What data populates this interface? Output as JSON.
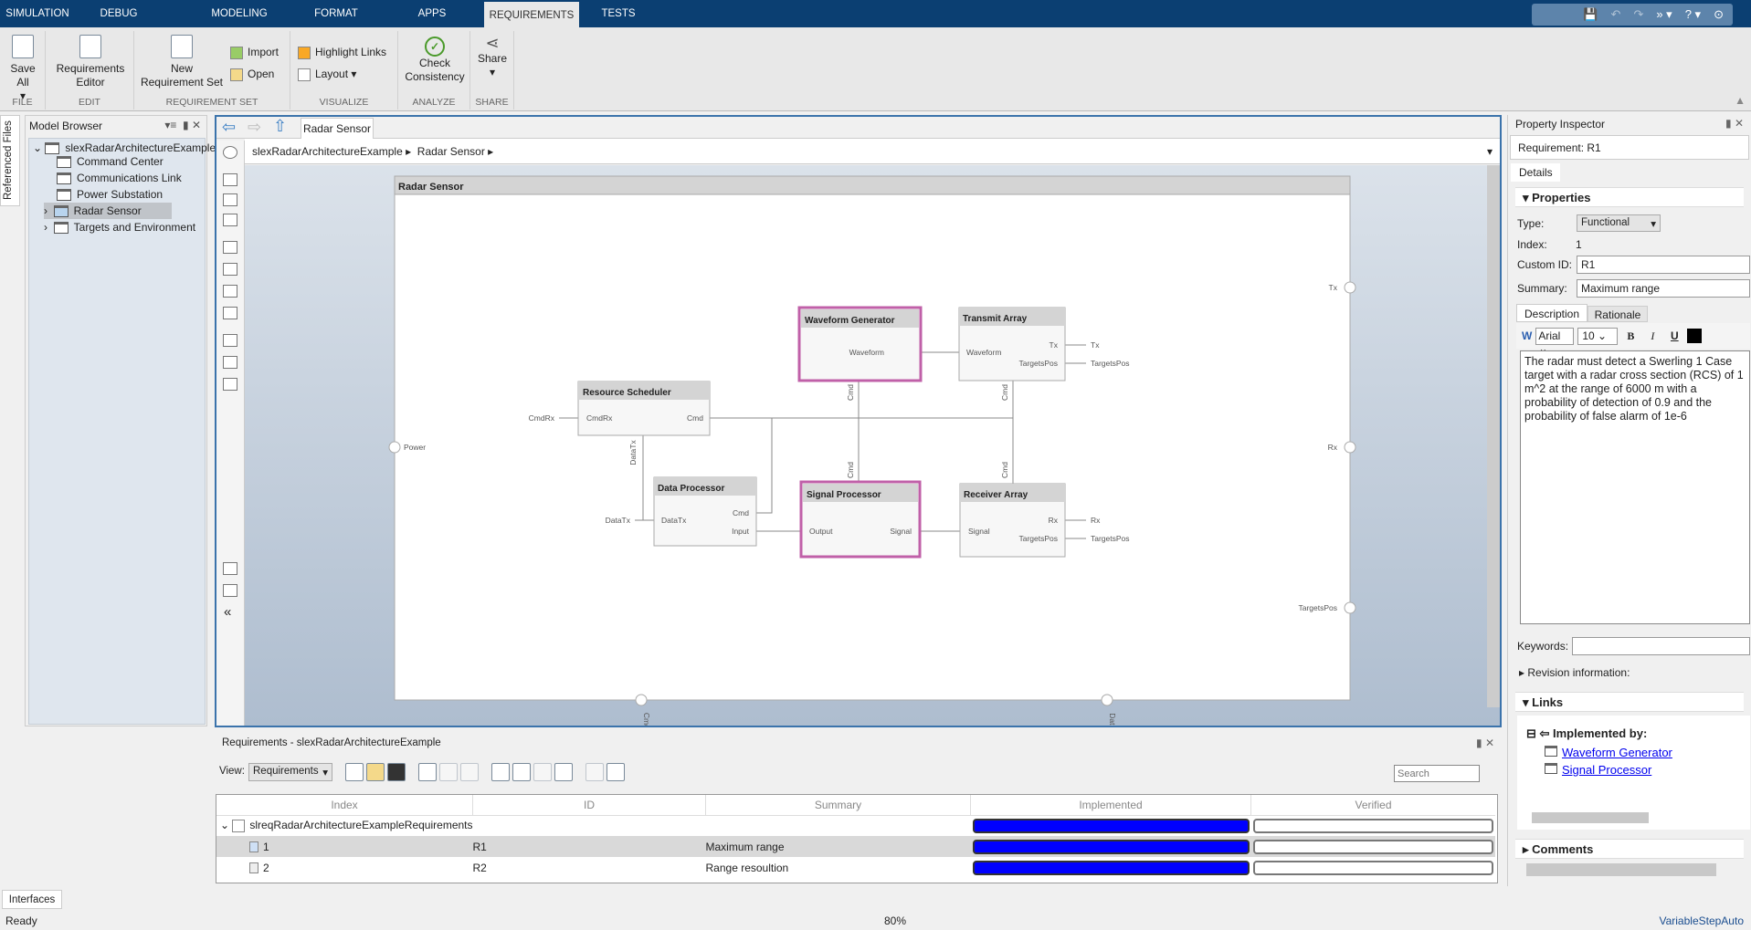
{
  "tabs": [
    "SIMULATION",
    "DEBUG",
    "MODELING",
    "FORMAT",
    "APPS",
    "REQUIREMENTS",
    "TESTS"
  ],
  "ribbon": {
    "groups": {
      "file": "FILE",
      "edit": "EDIT",
      "reqset": "REQUIREMENT SET",
      "visualize": "VISUALIZE",
      "analyze": "ANALYZE",
      "share": "SHARE"
    },
    "save_all": "Save All",
    "req_editor_1": "Requirements",
    "req_editor_2": "Editor",
    "new_req_1": "New",
    "new_req_2": "Requirement Set",
    "import": "Import",
    "open": "Open",
    "highlight_links": "Highlight Links",
    "layout": "Layout",
    "check_1": "Check",
    "check_2": "Consistency",
    "share": "Share"
  },
  "referenced_files": "Referenced Files",
  "model_browser": {
    "title": "Model Browser",
    "root": "slexRadarArchitectureExample",
    "items": [
      "Command Center",
      "Communications Link",
      "Power Substation",
      "Radar Sensor",
      "Targets and Environment"
    ],
    "selected": "Radar Sensor"
  },
  "editor": {
    "tab": "Radar Sensor",
    "breadcrumb": [
      "slexRadarArchitectureExample",
      "Radar Sensor"
    ]
  },
  "diagram": {
    "title": "Radar Sensor",
    "blocks": {
      "wg": "Waveform Generator",
      "ta": "Transmit Array",
      "rs": "Resource Scheduler",
      "dp": "Data Processor",
      "sp": "Signal Processor",
      "ra": "Receiver Array"
    },
    "ports": {
      "waveform": "Waveform",
      "tx": "Tx",
      "targetspos": "TargetsPos",
      "cmd": "Cmd",
      "cmdrx": "CmdRx",
      "datatx": "DataTx",
      "input": "Input",
      "output": "Output",
      "signal": "Signal",
      "rx": "Rx",
      "power": "Power"
    },
    "highlight_color": "#c060a8"
  },
  "requirements": {
    "title": "Requirements - slexRadarArchitectureExample",
    "view_label": "View:",
    "view_value": "Requirements",
    "search_placeholder": "Search",
    "columns": [
      "Index",
      "ID",
      "Summary",
      "Implemented",
      "Verified"
    ],
    "set_name": "slreqRadarArchitectureExampleRequirements",
    "rows": [
      {
        "index": "1",
        "id": "R1",
        "summary": "Maximum range",
        "implemented": 1.0,
        "verified": 0.0
      },
      {
        "index": "2",
        "id": "R2",
        "summary": "Range resoultion",
        "implemented": 1.0,
        "verified": 0.0
      }
    ],
    "implemented_color": "#0000ff"
  },
  "inspector": {
    "title": "Property Inspector",
    "header": "Requirement: R1",
    "tab": "Details",
    "properties": "Properties",
    "type_label": "Type:",
    "type_value": "Functional",
    "index_label": "Index:",
    "index_value": "1",
    "customid_label": "Custom ID:",
    "customid_value": "R1",
    "summary_label": "Summary:",
    "summary_value": "Maximum range",
    "desc_tabs": [
      "Description",
      "Rationale"
    ],
    "font": "Arial",
    "size": "10",
    "description": "The radar must detect a Swerling 1 Case target with a radar cross section (RCS) of 1 m^2 at the range of 6000 m with a probability of detection of 0.9 and the probability of false alarm of 1e-6",
    "keywords_label": "Keywords:",
    "revision": "Revision information:",
    "links": "Links",
    "implemented_by": "Implemented by:",
    "links_list": [
      "Waveform Generator",
      "Signal Processor"
    ],
    "comments": "Comments"
  },
  "bottom_tab": "Interfaces",
  "status": {
    "left": "Ready",
    "zoom": "80%",
    "solver": "VariableStepAuto"
  }
}
